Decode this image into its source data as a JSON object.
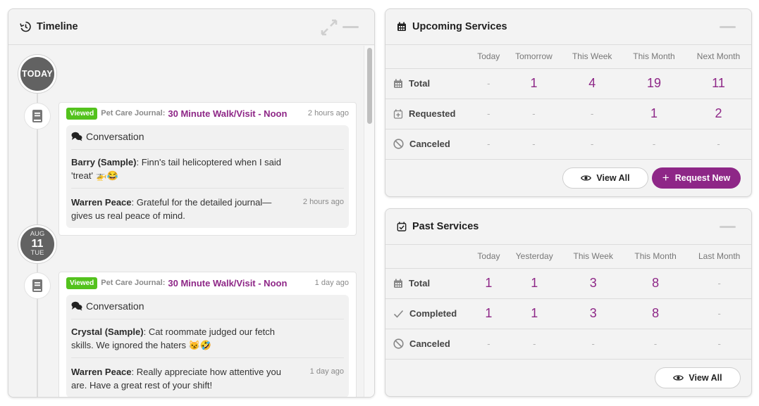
{
  "timeline": {
    "title": "Timeline",
    "today_label": "TODAY",
    "date2": {
      "month": "AUG",
      "day": "11",
      "weekday": "TUE"
    },
    "entries": [
      {
        "status": "Viewed",
        "journal_label": "Pet Care Journal:",
        "link": "30 Minute Walk/Visit - Noon",
        "time": "2 hours ago",
        "conversation_label": "Conversation",
        "messages": [
          {
            "author": "Barry (Sample)",
            "text": ": Finn's tail helicoptered when I said 'treat' 🚁😂",
            "time": ""
          },
          {
            "author": "Warren Peace",
            "text": ": Grateful for the detailed journal—gives us real peace of mind.",
            "time": "2 hours ago"
          }
        ]
      },
      {
        "status": "Viewed",
        "journal_label": "Pet Care Journal:",
        "link": "30 Minute Walk/Visit - Noon",
        "time": "1 day ago",
        "conversation_label": "Conversation",
        "messages": [
          {
            "author": "Crystal (Sample)",
            "text": ": Cat roommate judged our fetch skills. We ignored the haters 😼🤣",
            "time": ""
          },
          {
            "author": "Warren Peace",
            "text": ": Really appreciate how attentive you are. Have a great rest of your shift!",
            "time": "1 day ago"
          }
        ]
      }
    ]
  },
  "upcoming": {
    "title": "Upcoming Services",
    "columns": [
      "Today",
      "Tomorrow",
      "This Week",
      "This Month",
      "Next Month"
    ],
    "rows": [
      {
        "label": "Total",
        "values": [
          "-",
          "1",
          "4",
          "19",
          "11"
        ]
      },
      {
        "label": "Requested",
        "values": [
          "-",
          "-",
          "-",
          "1",
          "2"
        ]
      },
      {
        "label": "Canceled",
        "values": [
          "-",
          "-",
          "-",
          "-",
          "-"
        ]
      }
    ],
    "view_all": "View All",
    "request_new": "Request New"
  },
  "past": {
    "title": "Past Services",
    "columns": [
      "Today",
      "Yesterday",
      "This Week",
      "This Month",
      "Last Month"
    ],
    "rows": [
      {
        "label": "Total",
        "values": [
          "1",
          "1",
          "3",
          "8",
          "-"
        ]
      },
      {
        "label": "Completed",
        "values": [
          "1",
          "1",
          "3",
          "8",
          "-"
        ]
      },
      {
        "label": "Canceled",
        "values": [
          "-",
          "-",
          "-",
          "-",
          "-"
        ]
      }
    ],
    "view_all": "View All"
  },
  "colors": {
    "accent": "#8e2787",
    "viewed_badge": "#53c21d",
    "date_circle": "#626262"
  }
}
